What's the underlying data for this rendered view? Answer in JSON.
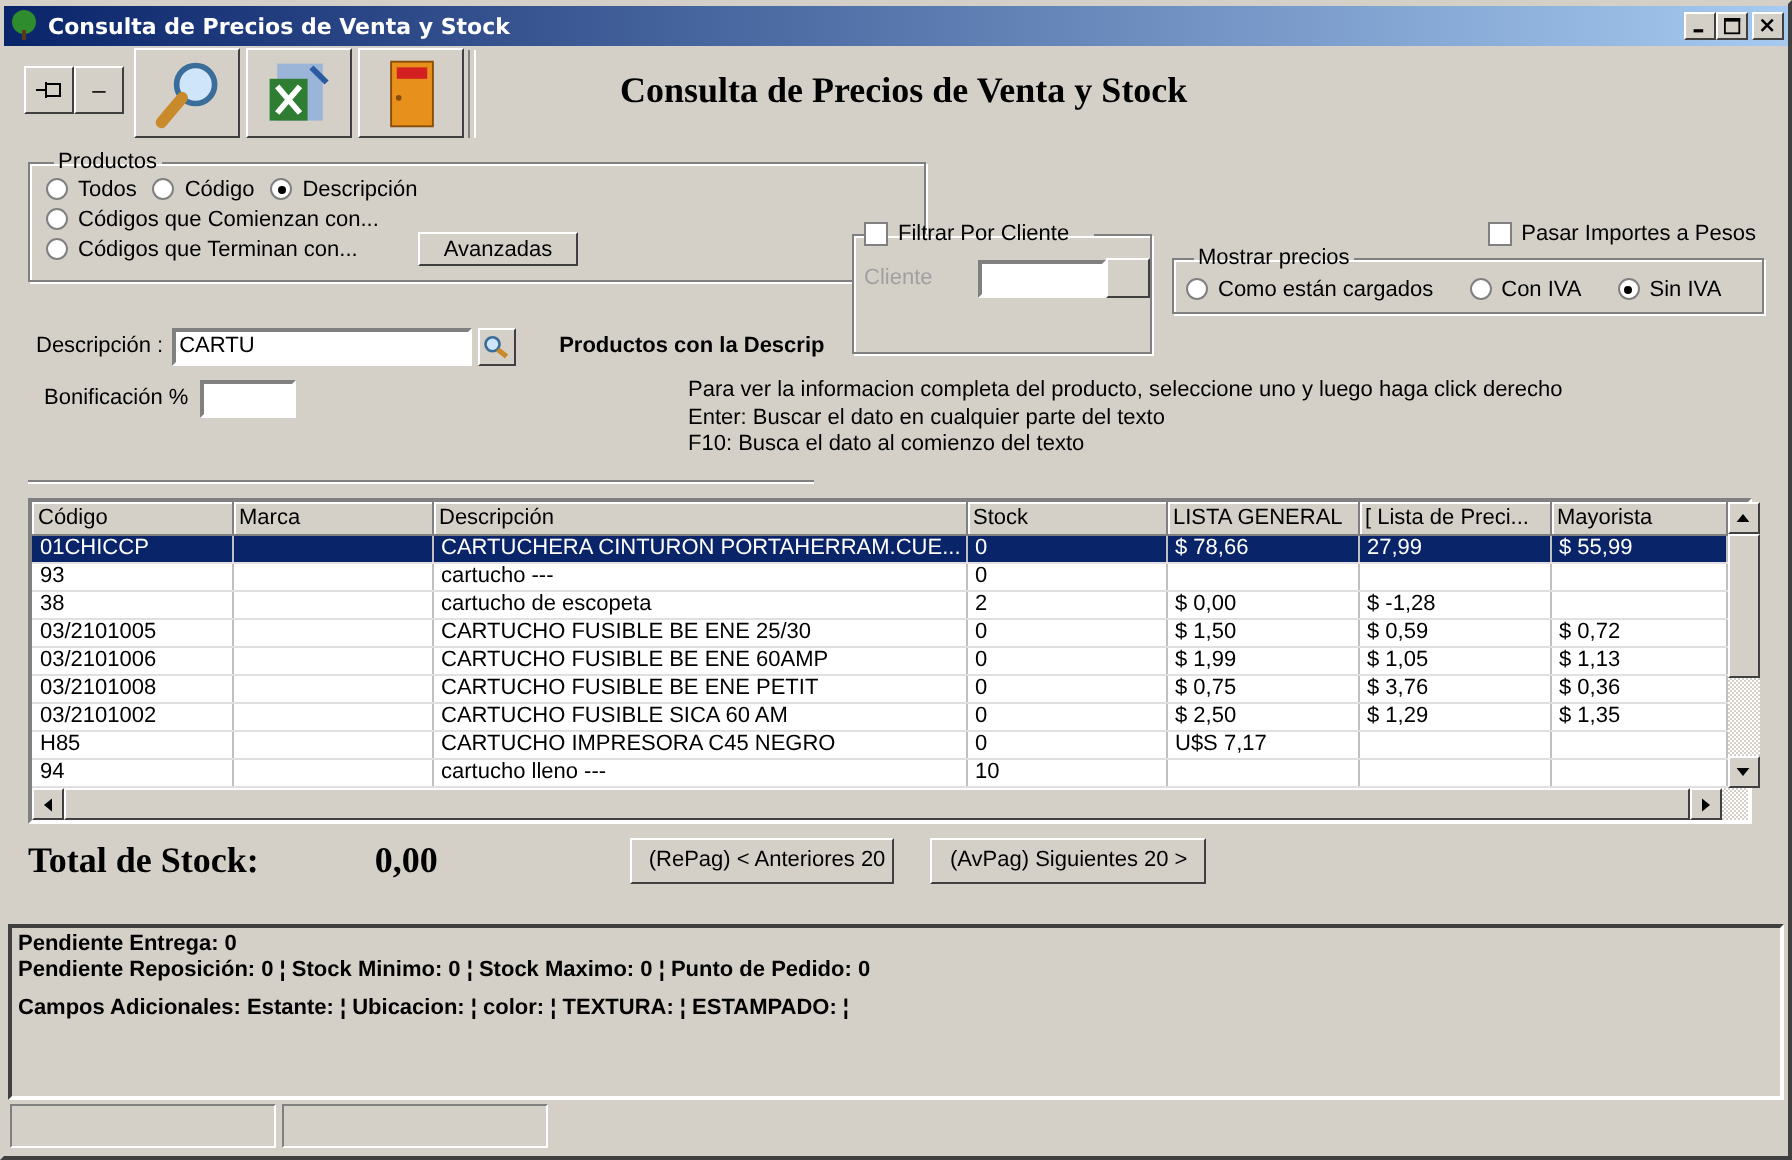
{
  "window": {
    "title": "Consulta de Precios de Venta y Stock"
  },
  "toolbar": {
    "collapse_button": "–"
  },
  "heading": "Consulta de Precios de Venta y Stock",
  "productos": {
    "label": "Productos",
    "options": [
      {
        "label": "Todos",
        "selected": false
      },
      {
        "label": "Código",
        "selected": false
      },
      {
        "label": "Descripción",
        "selected": true
      },
      {
        "label": "Códigos que Comienzan con...",
        "selected": false
      },
      {
        "label": "Códigos que Terminan con...",
        "selected": false
      }
    ],
    "advanced_button": "Avanzadas"
  },
  "descripcion": {
    "label": "Descripción :",
    "value": "CARTU"
  },
  "bonificacion": {
    "label": "Bonificación %"
  },
  "results_caption": "Productos con la Descrip",
  "filter_client": {
    "label": "Filtrar Por Cliente",
    "checked": false,
    "field_label": "Cliente"
  },
  "pasar_importes": {
    "label": "Pasar Importes a Pesos",
    "checked": false
  },
  "mostrar_precios": {
    "label": "Mostrar precios",
    "options": [
      {
        "label": "Como están cargados",
        "selected": false
      },
      {
        "label": "Con IVA",
        "selected": false
      },
      {
        "label": "Sin IVA",
        "selected": true
      }
    ]
  },
  "help_lines": [
    "Para ver la informacion completa del producto, seleccione uno y luego haga click derecho",
    "Enter: Buscar el dato en cualquier parte del texto",
    "F10: Busca el dato al comienzo del texto"
  ],
  "table": {
    "columns": [
      "Código",
      "Marca",
      "Descripción",
      "Stock",
      "LISTA GENERAL",
      "[ Lista de Preci...",
      "Mayorista"
    ],
    "rows": [
      {
        "selected": true,
        "cells": [
          "01CHICCP",
          null,
          "CARTUCHERA CINTURON PORTAHERRAM.CUE...",
          "0",
          "$ 78,66",
          " 27,99",
          "$ 55,99"
        ]
      },
      {
        "selected": false,
        "cells": [
          "93",
          null,
          "cartucho ---",
          "0",
          null,
          null,
          null
        ]
      },
      {
        "selected": false,
        "cells": [
          "38",
          null,
          "cartucho de escopeta",
          "2",
          "$ 0,00",
          "$ -1,28",
          null
        ]
      },
      {
        "selected": false,
        "cells": [
          "03/2101005",
          null,
          "CARTUCHO FUSIBLE BE  ENE 25/30",
          "0",
          "$ 1,50",
          "$ 0,59",
          "$ 0,72"
        ]
      },
      {
        "selected": false,
        "cells": [
          "03/2101006",
          null,
          "CARTUCHO FUSIBLE BE ENE 60AMP",
          "0",
          "$ 1,99",
          "$ 1,05",
          "$ 1,13"
        ]
      },
      {
        "selected": false,
        "cells": [
          "03/2101008",
          null,
          "CARTUCHO FUSIBLE BE ENE PETIT",
          "0",
          "$ 0,75",
          "$ 3,76",
          "$ 0,36"
        ]
      },
      {
        "selected": false,
        "cells": [
          "03/2101002",
          null,
          "CARTUCHO FUSIBLE SICA 60 AM",
          "0",
          "$ 2,50",
          "$ 1,29",
          "$ 1,35"
        ]
      },
      {
        "selected": false,
        "cells": [
          "H85",
          null,
          "CARTUCHO IMPRESORA C45 NEGRO",
          "0",
          "U$S 7,17",
          null,
          null
        ]
      },
      {
        "selected": false,
        "cells": [
          "94",
          null,
          "cartucho lleno ---",
          "10",
          null,
          null,
          null
        ]
      }
    ]
  },
  "total": {
    "label": "Total de Stock:",
    "value": "0,00"
  },
  "paging_buttons": [
    "(RePag) < Anteriores 20",
    "(AvPag) Siguientes 20 >"
  ],
  "info_lines": [
    "Pendiente Entrega: 0",
    "Pendiente Reposición: 0 ¦ Stock Minimo: 0 ¦ Stock Maximo: 0 ¦ Punto de Pedido: 0",
    "Campos Adicionales: Estante: ¦ Ubicacion: ¦ color: ¦ TEXTURA: ¦ ESTAMPADO: ¦"
  ]
}
